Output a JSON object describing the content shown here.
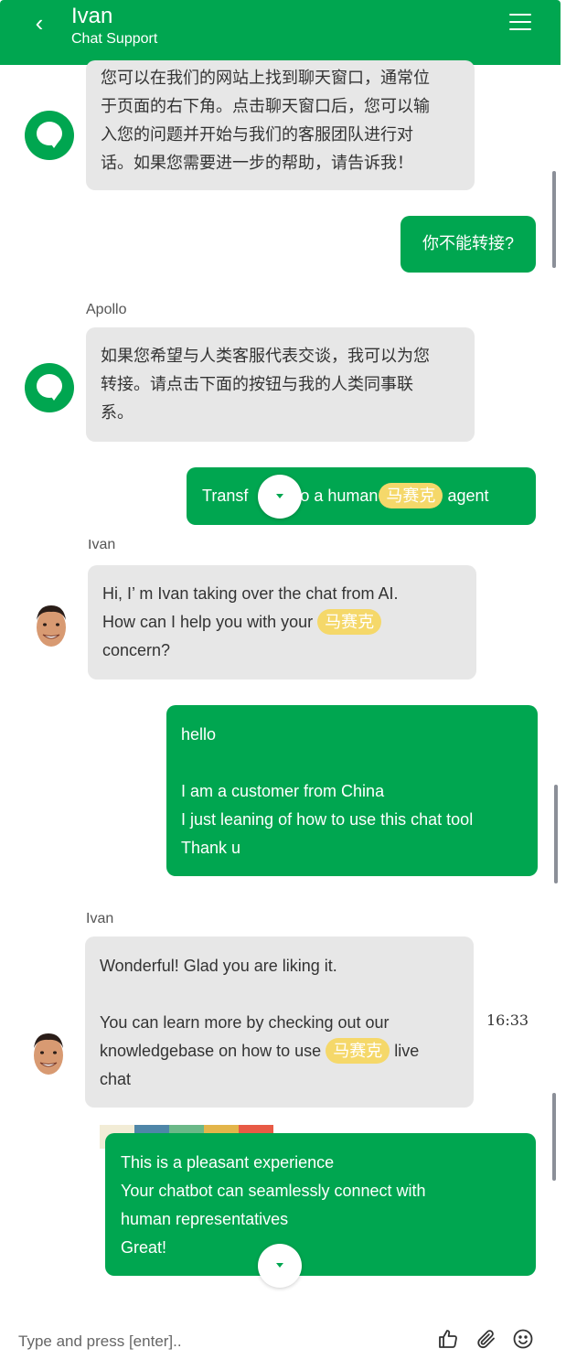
{
  "header": {
    "back_glyph": "‹",
    "title": "Ivan",
    "subtitle": "Chat Support"
  },
  "messages": {
    "m1_text": "您可以在我们的网站上找到聊天窗口，通常位\n于页面的右下角。点击聊天窗口后，您可以输\n入您的问题并开始与我们的客服团队进行对\n话。如果您需要进一步的帮助，请告诉我！",
    "m2_text": "你不能转接?",
    "m3_sender": "Apollo",
    "m3_text": "如果您希望与人类客服代表交谈，我可以为您\n转接。请点击下面的按钮与我的人类同事联\n系。",
    "m4_text_a": "Transf",
    "m4_text_b": "to a human",
    "m4_pill": "马赛克",
    "m4_text_c": "agent",
    "m5_sender": "Ivan",
    "m5_line1": "Hi, I’  m Ivan taking over the chat from AI.",
    "m5_line2": "How can I help you with your",
    "m5_pill": "马赛克",
    "m5_line3": "concern?",
    "m6_text": "hello\n\nI am a customer from China\nI just leaning of how to use this chat tool\nThank u",
    "m7_sender": "Ivan",
    "m7_line1": "Wonderful! Glad you are liking it.",
    "m7_line2": "You can learn more by checking out our",
    "m7_line3a": "knowledgebase on how to use",
    "m7_pill": "马赛克",
    "m7_line3b": "live",
    "m7_line4": "chat",
    "m7_time": "16:33",
    "m8_text": "This is a pleasant experience\nYour chatbot can seamlessly connect with\nhuman representatives\nGreat!"
  },
  "input": {
    "placeholder": "Type and press [enter].."
  },
  "icons": {
    "thumbs_up": "thumbs-up-icon",
    "attach": "paperclip-icon",
    "emoji": "smiley-icon"
  },
  "colors": {
    "brand": "#00a650",
    "bot_bubble": "#e7e7e7",
    "mosaic_pill": "#f5d86a",
    "strip": [
      "#f2ecd6",
      "#4f86a8",
      "#6bb888",
      "#e3b54a",
      "#e85a45"
    ]
  }
}
